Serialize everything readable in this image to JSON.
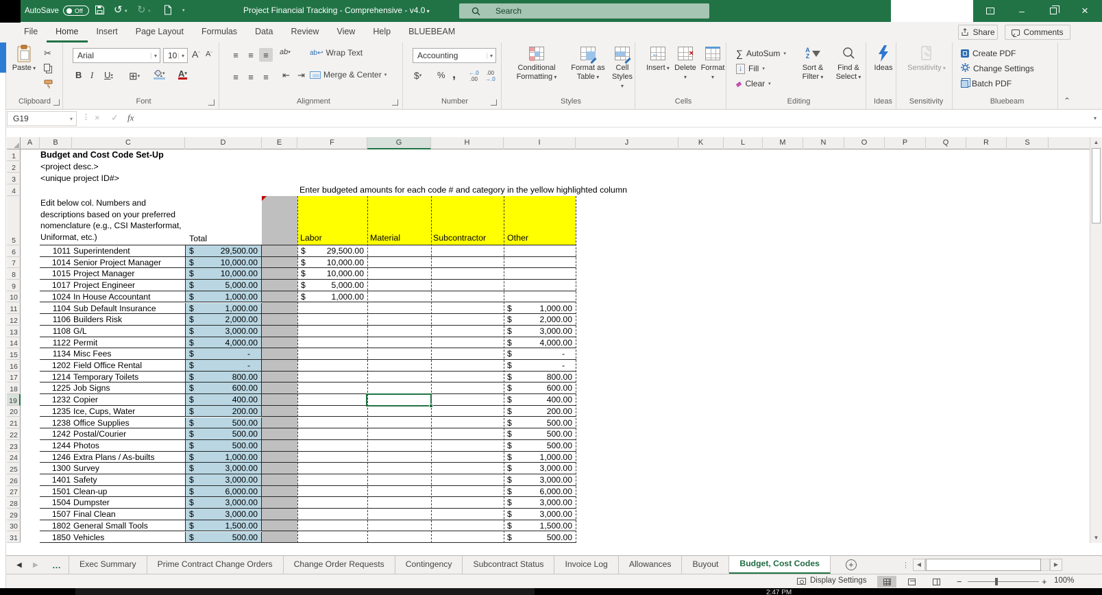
{
  "window": {
    "title": "Project Financial Tracking - Comprehensive - v4.0",
    "autosave_label": "AutoSave",
    "autosave_state": "Off",
    "search_placeholder": "Search",
    "share_label": "Share",
    "comments_label": "Comments",
    "clock": "2:47 PM"
  },
  "icons": {
    "cut": "✂",
    "undo": "↺",
    "redo": "↻",
    "close": "×",
    "minimize": "–",
    "borders": "⊞",
    "align": "≡",
    "indent_left": "⇤",
    "indent_right": "⇥",
    "wrap_arrow": "ab↩",
    "orientation": "ab",
    "autosum": "∑",
    "fill_arrow": "↓",
    "clear_diamond": "◆",
    "cancel": "×",
    "enter": "✓",
    "fx": "fx",
    "prev_sheet": "◀",
    "next_sheet": "▶",
    "more_sheets": "…",
    "add_sheet": "+",
    "scroll_up": "▲",
    "scroll_down": "▼",
    "zoom_out": "−",
    "zoom_in": "+",
    "collapse_ribbon": "⌃",
    "dots": "⋮",
    "grow_font": "A",
    "shrink_font": "A"
  },
  "menu_tabs": [
    {
      "label": "File",
      "active": false
    },
    {
      "label": "Home",
      "active": true
    },
    {
      "label": "Insert",
      "active": false
    },
    {
      "label": "Page Layout",
      "active": false
    },
    {
      "label": "Formulas",
      "active": false
    },
    {
      "label": "Data",
      "active": false
    },
    {
      "label": "Review",
      "active": false
    },
    {
      "label": "View",
      "active": false
    },
    {
      "label": "Help",
      "active": false
    },
    {
      "label": "BLUEBEAM",
      "active": false
    }
  ],
  "ribbon": {
    "clipboard": {
      "label": "Clipboard",
      "paste": "Paste"
    },
    "font": {
      "label": "Font",
      "name": "Arial",
      "size": "10",
      "bold": "B",
      "italic": "I",
      "underline": "U"
    },
    "alignment": {
      "label": "Alignment",
      "wrap": "Wrap Text",
      "merge": "Merge & Center"
    },
    "number": {
      "label": "Number",
      "format": "Accounting",
      "currency": "$",
      "percent": "%",
      "comma": ","
    },
    "styles": {
      "label": "Styles",
      "conditional": "Conditional Formatting",
      "format_table": "Format as Table",
      "cell_styles": "Cell Styles"
    },
    "cells": {
      "label": "Cells",
      "insert": "Insert",
      "delete": "Delete",
      "format": "Format"
    },
    "editing": {
      "label": "Editing",
      "autosum": "AutoSum",
      "fill": "Fill",
      "clear": "Clear",
      "sort": "Sort & Filter",
      "find": "Find & Select"
    },
    "ideas": {
      "label": "Ideas",
      "button": "Ideas"
    },
    "sensitivity": {
      "label": "Sensitivity",
      "button": "Sensitivity"
    },
    "bluebeam": {
      "label": "Bluebeam",
      "create_pdf": "Create PDF",
      "change_settings": "Change Settings",
      "batch_pdf": "Batch PDF"
    }
  },
  "formula_bar": {
    "name_box": "G19",
    "formula": ""
  },
  "sheet": {
    "columns": [
      "A",
      "B",
      "C",
      "D",
      "E",
      "F",
      "G",
      "H",
      "I",
      "J",
      "K",
      "L",
      "M",
      "N",
      "O",
      "P",
      "Q",
      "R",
      "S"
    ],
    "selected_cell": "G19",
    "selected_column": "G",
    "selected_row": 19,
    "currency": "$",
    "row1_title": "Budget and Cost Code Set-Up",
    "row2": "<project desc.>",
    "row3": "<unique project ID#>",
    "row4_instruction": "Enter budgeted amounts for each code # and category in the yellow highlighted column",
    "row5_note": "Edit below col. Numbers and descriptions based on your preferred nomenclature (e.g., CSI Masterformat, Uniformat, etc.)",
    "header_total": "Total",
    "category_headers": [
      "Labor",
      "Material",
      "Subcontractor",
      "Other"
    ],
    "rows": [
      {
        "r": 6,
        "code": "1011",
        "desc": "Superintendent",
        "total": "29,500.00",
        "labor": "29,500.00",
        "other": null
      },
      {
        "r": 7,
        "code": "1014",
        "desc": "Senior Project Manager",
        "total": "10,000.00",
        "labor": "10,000.00",
        "other": null
      },
      {
        "r": 8,
        "code": "1015",
        "desc": "Project Manager",
        "total": "10,000.00",
        "labor": "10,000.00",
        "other": null
      },
      {
        "r": 9,
        "code": "1017",
        "desc": "Project Engineer",
        "total": "5,000.00",
        "labor": "5,000.00",
        "other": null
      },
      {
        "r": 10,
        "code": "1024",
        "desc": "In House Accountant",
        "total": "1,000.00",
        "labor": "1,000.00",
        "other": null
      },
      {
        "r": 11,
        "code": "1104",
        "desc": "Sub Default Insurance",
        "total": "1,000.00",
        "labor": null,
        "other": "1,000.00"
      },
      {
        "r": 12,
        "code": "1106",
        "desc": "Builders Risk",
        "total": "2,000.00",
        "labor": null,
        "other": "2,000.00"
      },
      {
        "r": 13,
        "code": "1108",
        "desc": "G/L",
        "total": "3,000.00",
        "labor": null,
        "other": "3,000.00"
      },
      {
        "r": 14,
        "code": "1122",
        "desc": "Permit",
        "total": "4,000.00",
        "labor": null,
        "other": "4,000.00"
      },
      {
        "r": 15,
        "code": "1134",
        "desc": "Misc Fees",
        "total": "-",
        "labor": null,
        "other": "-"
      },
      {
        "r": 16,
        "code": "1202",
        "desc": "Field Office Rental",
        "total": "-",
        "labor": null,
        "other": "-"
      },
      {
        "r": 17,
        "code": "1214",
        "desc": "Temporary Toilets",
        "total": "800.00",
        "labor": null,
        "other": "800.00"
      },
      {
        "r": 18,
        "code": "1225",
        "desc": "Job Signs",
        "total": "600.00",
        "labor": null,
        "other": "600.00"
      },
      {
        "r": 19,
        "code": "1232",
        "desc": "Copier",
        "total": "400.00",
        "labor": null,
        "other": "400.00"
      },
      {
        "r": 20,
        "code": "1235",
        "desc": "Ice, Cups, Water",
        "total": "200.00",
        "labor": null,
        "other": "200.00"
      },
      {
        "r": 21,
        "code": "1238",
        "desc": "Office Supplies",
        "total": "500.00",
        "labor": null,
        "other": "500.00"
      },
      {
        "r": 22,
        "code": "1242",
        "desc": "Postal/Courier",
        "total": "500.00",
        "labor": null,
        "other": "500.00"
      },
      {
        "r": 23,
        "code": "1244",
        "desc": "Photos",
        "total": "500.00",
        "labor": null,
        "other": "500.00"
      },
      {
        "r": 24,
        "code": "1246",
        "desc": "Extra Plans / As-builts",
        "total": "1,000.00",
        "labor": null,
        "other": "1,000.00"
      },
      {
        "r": 25,
        "code": "1300",
        "desc": "Survey",
        "total": "3,000.00",
        "labor": null,
        "other": "3,000.00"
      },
      {
        "r": 26,
        "code": "1401",
        "desc": "Safety",
        "total": "3,000.00",
        "labor": null,
        "other": "3,000.00"
      },
      {
        "r": 27,
        "code": "1501",
        "desc": "Clean-up",
        "total": "6,000.00",
        "labor": null,
        "other": "6,000.00"
      },
      {
        "r": 28,
        "code": "1504",
        "desc": "Dumpster",
        "total": "3,000.00",
        "labor": null,
        "other": "3,000.00"
      },
      {
        "r": 29,
        "code": "1507",
        "desc": "Final Clean",
        "total": "3,000.00",
        "labor": null,
        "other": "3,000.00"
      },
      {
        "r": 30,
        "code": "1802",
        "desc": "General Small Tools",
        "total": "1,500.00",
        "labor": null,
        "other": "1,500.00"
      },
      {
        "r": 31,
        "code": "1850",
        "desc": "Vehicles",
        "total": "500.00",
        "labor": null,
        "other": "500.00"
      }
    ]
  },
  "sheet_tabs": {
    "tabs": [
      "Exec Summary",
      "Prime Contract Change Orders",
      "Change Order Requests",
      "Contingency",
      "Subcontract Status",
      "Invoice Log",
      "Allowances",
      "Buyout",
      "Budget, Cost Codes"
    ],
    "active": "Budget, Cost Codes"
  },
  "status_bar": {
    "display_settings": "Display Settings",
    "zoom_level": "100%"
  },
  "colors": {
    "accent_green": "#217346",
    "highlight_yellow": "#ffff00",
    "total_blue": "#b9d6e2",
    "spacer_gray": "#bfbfbf"
  }
}
